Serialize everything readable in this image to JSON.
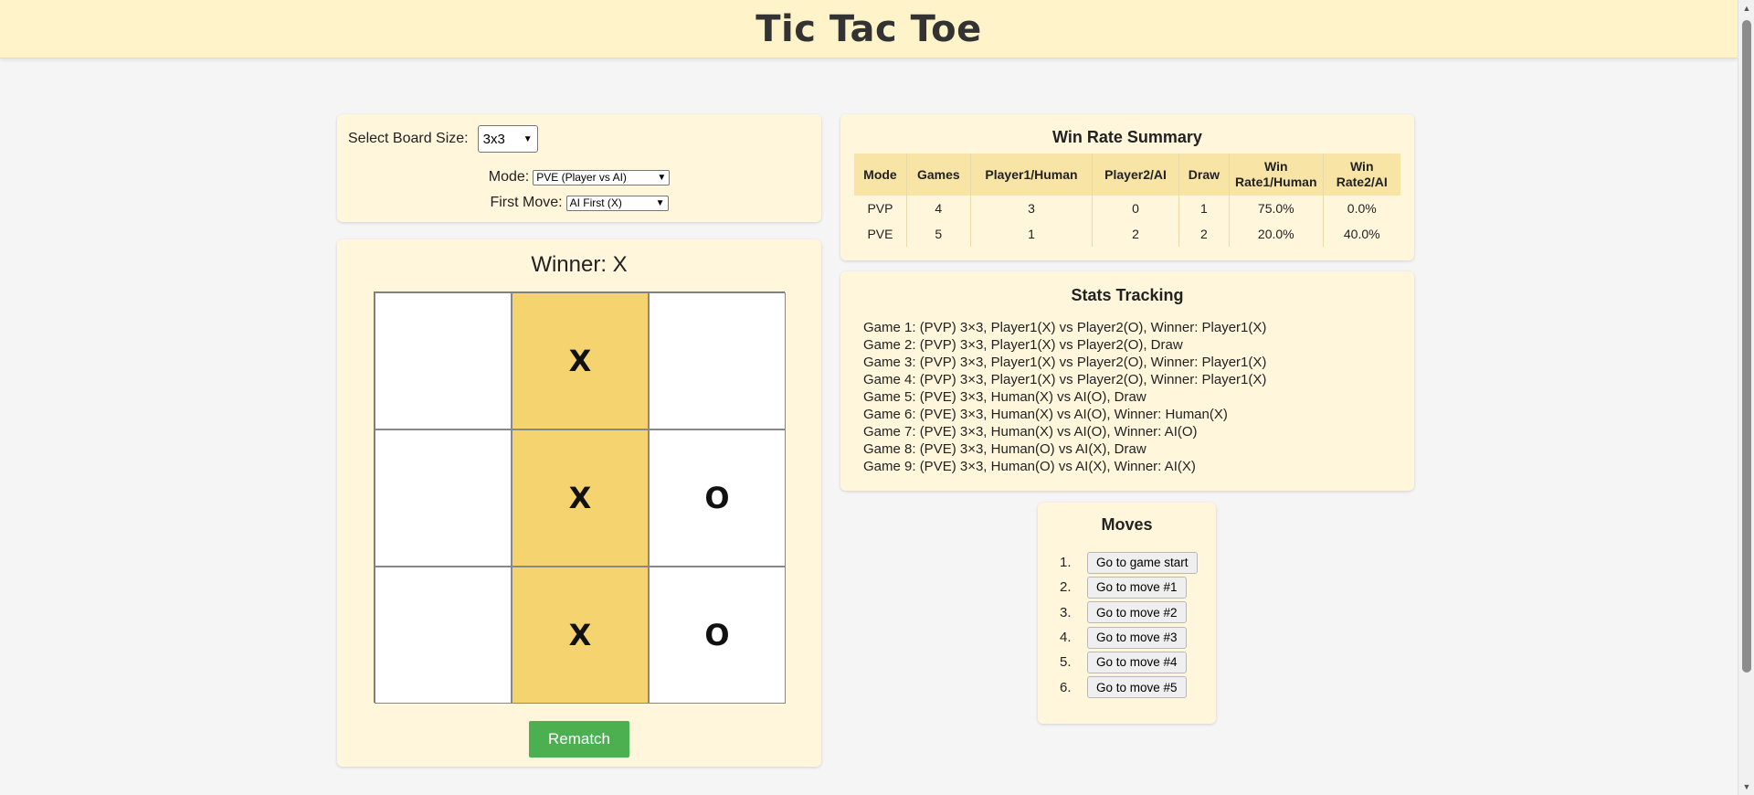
{
  "header": {
    "title": "Tic Tac Toe"
  },
  "settings": {
    "board_size_label": "Select Board Size:",
    "board_size_value": "3x3",
    "mode_label": "Mode:",
    "mode_value": "PVE (Player vs AI)",
    "first_move_label": "First Move:",
    "first_move_value": "AI First (X)"
  },
  "game": {
    "status": "Winner: X",
    "cells": [
      "",
      "X",
      "",
      "",
      "X",
      "O",
      "",
      "X",
      "O"
    ],
    "winning_cells": [
      1,
      4,
      7
    ],
    "rematch_label": "Rematch"
  },
  "win_rate": {
    "title": "Win Rate Summary",
    "headers": [
      "Mode",
      "Games",
      "Player1/Human",
      "Player2/AI",
      "Draw",
      "Win Rate1/Human",
      "Win Rate2/AI"
    ],
    "rows": [
      [
        "PVP",
        "4",
        "3",
        "0",
        "1",
        "75.0%",
        "0.0%"
      ],
      [
        "PVE",
        "5",
        "1",
        "2",
        "2",
        "20.0%",
        "40.0%"
      ]
    ]
  },
  "stats": {
    "title": "Stats Tracking",
    "games": [
      "Game 1: (PVP) 3×3, Player1(X) vs Player2(O), Winner: Player1(X)",
      "Game 2: (PVP) 3×3, Player1(X) vs Player2(O), Draw",
      "Game 3: (PVP) 3×3, Player1(X) vs Player2(O), Winner: Player1(X)",
      "Game 4: (PVP) 3×3, Player1(X) vs Player2(O), Winner: Player1(X)",
      "Game 5: (PVE) 3×3, Human(X) vs AI(O), Draw",
      "Game 6: (PVE) 3×3, Human(X) vs AI(O), Winner: Human(X)",
      "Game 7: (PVE) 3×3, Human(X) vs AI(O), Winner: AI(O)",
      "Game 8: (PVE) 3×3, Human(O) vs AI(X), Draw",
      "Game 9: (PVE) 3×3, Human(O) vs AI(X), Winner: AI(X)"
    ]
  },
  "moves": {
    "title": "Moves",
    "items": [
      {
        "num": "1.",
        "label": "Go to game start"
      },
      {
        "num": "2.",
        "label": "Go to move #1"
      },
      {
        "num": "3.",
        "label": "Go to move #2"
      },
      {
        "num": "4.",
        "label": "Go to move #3"
      },
      {
        "num": "5.",
        "label": "Go to move #4"
      },
      {
        "num": "6.",
        "label": "Go to move #5"
      }
    ]
  },
  "icons": {
    "select_chevron": "chevron-down-icon",
    "scroll_up": "triangle-up-icon",
    "scroll_down": "triangle-down-icon"
  }
}
